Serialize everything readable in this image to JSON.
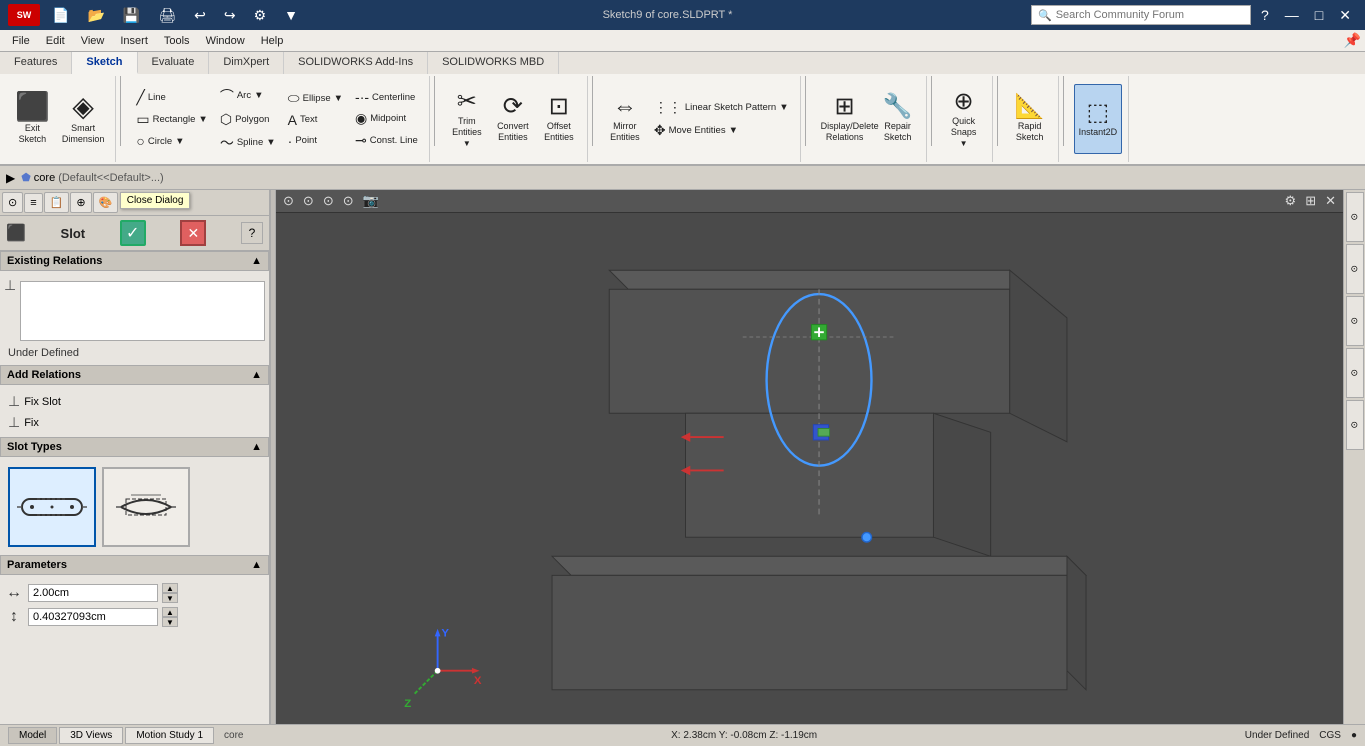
{
  "titleBar": {
    "appName": "SOLIDWORKS",
    "docTitle": "Sketch9 of core.SLDPRT *",
    "searchPlaceholder": "Search Community Forum",
    "winBtns": [
      "—",
      "□",
      "✕"
    ]
  },
  "menuBar": {
    "items": [
      "File",
      "Edit",
      "View",
      "Insert",
      "Tools",
      "Window",
      "Help"
    ]
  },
  "ribbon": {
    "tabs": [
      "Features",
      "Sketch",
      "Evaluate",
      "DimXpert",
      "SOLIDWORKS Add-Ins",
      "SOLIDWORKS MBD"
    ],
    "activeTab": "Sketch",
    "groups": [
      {
        "name": "exit",
        "buttons": [
          {
            "id": "exit-sketch",
            "icon": "⬛",
            "label": "Exit Sketch",
            "active": false
          },
          {
            "id": "smart-dim",
            "icon": "◈",
            "label": "Smart Dimension",
            "active": false
          }
        ]
      },
      {
        "name": "draw",
        "buttons": []
      },
      {
        "name": "trim",
        "buttons": [
          {
            "id": "trim",
            "icon": "✂",
            "label": "Trim Entities",
            "active": false
          },
          {
            "id": "convert",
            "icon": "⟳",
            "label": "Convert Entities",
            "active": false
          },
          {
            "id": "offset",
            "icon": "⊡",
            "label": "Offset Entities",
            "active": false
          }
        ]
      },
      {
        "name": "mirror",
        "buttons": [
          {
            "id": "mirror",
            "icon": "⇔",
            "label": "Mirror Entities",
            "active": false
          },
          {
            "id": "linear-pattern",
            "icon": "⋮⋮",
            "label": "Linear Sketch Pattern",
            "active": false
          },
          {
            "id": "move",
            "icon": "✥",
            "label": "Move Entities",
            "active": false
          }
        ]
      },
      {
        "name": "relations",
        "buttons": [
          {
            "id": "display-delete",
            "icon": "⊞",
            "label": "Display/Delete Relations",
            "active": false
          },
          {
            "id": "repair",
            "icon": "🔧",
            "label": "Repair Sketch",
            "active": false
          }
        ]
      },
      {
        "name": "quick-snaps",
        "buttons": [
          {
            "id": "quick-snaps",
            "icon": "⊕",
            "label": "Quick Snaps",
            "active": false
          }
        ]
      },
      {
        "name": "rapid",
        "buttons": [
          {
            "id": "rapid-sketch",
            "icon": "📐",
            "label": "Rapid Sketch",
            "active": false
          }
        ]
      },
      {
        "name": "instant2d",
        "buttons": [
          {
            "id": "instant2d",
            "icon": "⬚",
            "label": "Instant2D",
            "active": true
          }
        ]
      }
    ]
  },
  "featureTree": {
    "items": [
      {
        "label": "core",
        "detail": "(Default<<Default>...)"
      }
    ]
  },
  "leftPanel": {
    "title": "Slot",
    "closeDialogTooltip": "Close Dialog",
    "checkmark": "✓",
    "sections": {
      "existingRelations": {
        "label": "Existing Relations",
        "status": "Under Defined"
      },
      "addRelations": {
        "label": "Add Relations",
        "items": [
          {
            "icon": "⊥",
            "label": "Fix Slot"
          },
          {
            "icon": "⊥",
            "label": "Fix"
          }
        ]
      },
      "slotTypes": {
        "label": "Slot Types"
      },
      "parameters": {
        "label": "Parameters",
        "rows": [
          {
            "icon": "↔",
            "value": "2.00cm"
          },
          {
            "icon": "↕",
            "value": "0.40327093cm"
          }
        ]
      }
    }
  },
  "statusBar": {
    "filename": "core",
    "tabs": [
      "Model",
      "3D Views",
      "Motion Study 1"
    ],
    "activeTab": "Model",
    "coordinates": "X: 2.38cm  Y: -0.08cm  Z: -1.19cm",
    "status": "Under Defined",
    "mode": "CGS",
    "indicator": "●"
  },
  "viewport": {
    "toolbarBtns": [
      "⊙",
      "⊙",
      "⊙",
      "⊙",
      "⊙",
      "⊙",
      "⊙",
      "⊙",
      "⊙",
      "⊙",
      "⊙",
      "⊙",
      "⊙",
      "⊙",
      "⊙",
      "⊙",
      "⊙",
      "⊙",
      "⊙",
      "⊙"
    ],
    "axisLabels": {
      "x": "X",
      "y": "Y",
      "z": "Z"
    }
  }
}
